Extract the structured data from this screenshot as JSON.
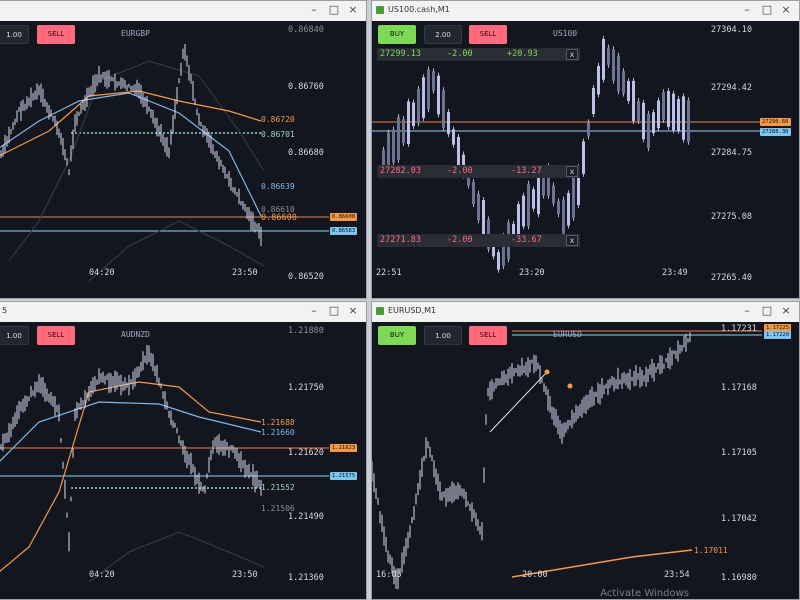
{
  "windows": {
    "eurgbp": {
      "title": "",
      "buttons": {
        "lot": "1.00",
        "sell": "SELL"
      },
      "symbol": "EURGBP",
      "price_labels": [
        "0.86840",
        "0.86760",
        "0.86720",
        "0.86701",
        "0.86680",
        "0.86639",
        "0.86610",
        "0.86600",
        "0.86520"
      ],
      "time_labels": [
        "04:20",
        "23:50"
      ],
      "tags": {
        "orange": "0.86600",
        "blue": "0.86583"
      }
    },
    "us100": {
      "title": "US100.cash,M1",
      "buttons": {
        "buy": "BUY",
        "lot": "2.00",
        "sell": "SELL"
      },
      "symbol": "US100",
      "price_labels": [
        "27304.10",
        "27294.42",
        "27284.75",
        "27275.08",
        "27265.40"
      ],
      "time_labels": [
        "22:51",
        "23:20",
        "23:49"
      ],
      "tags": {
        "orange": "27290.60",
        "blue": "27288.30"
      },
      "orders": [
        {
          "price": "27299.13",
          "lots": "-2.00",
          "pnl": "+20.93",
          "close": "x"
        },
        {
          "price": "27282.03",
          "lots": "-2.00",
          "pnl": "-13.27",
          "close": "x"
        },
        {
          "price": "27271.83",
          "lots": "-2.00",
          "pnl": "-33.67",
          "close": "x"
        }
      ]
    },
    "audnzd": {
      "title": "5",
      "buttons": {
        "lot": "1.00",
        "sell": "SELL"
      },
      "symbol": "AUDNZD",
      "price_labels": [
        "1.21880",
        "1.21750",
        "1.21688",
        "1.21660",
        "1.21620",
        "1.21552",
        "1.21506",
        "1.21490",
        "1.21360"
      ],
      "time_labels": [
        "04:20",
        "23:50"
      ],
      "tags": {
        "orange": "1.21623",
        "blue": "1.21575"
      }
    },
    "eurusd": {
      "title": "EURUSD,M1",
      "buttons": {
        "buy": "BUY",
        "lot": "1.00",
        "sell": "SELL"
      },
      "symbol": "EURUSD",
      "price_labels": [
        "1.17231",
        "1.17168",
        "1.17105",
        "1.17042",
        "1.17011",
        "1.16980"
      ],
      "time_labels": [
        "16:05",
        "20:00",
        "23:54"
      ],
      "tags": {
        "orange": "1.17225",
        "blue": "1.17220"
      }
    }
  },
  "watermark": "Activate Windows",
  "colors": {
    "background": "#14161f",
    "price": "#d5d9f2",
    "ma_orange": "#f39a4a",
    "ma_blue": "#7fb8e6",
    "buy": "#7ed957",
    "sell": "#ff6b7d",
    "order_positive": "#7ed957",
    "order_negative": "#ff6b7d",
    "level_orange": "#e8844a",
    "level_blue": "#8fd0f0"
  }
}
